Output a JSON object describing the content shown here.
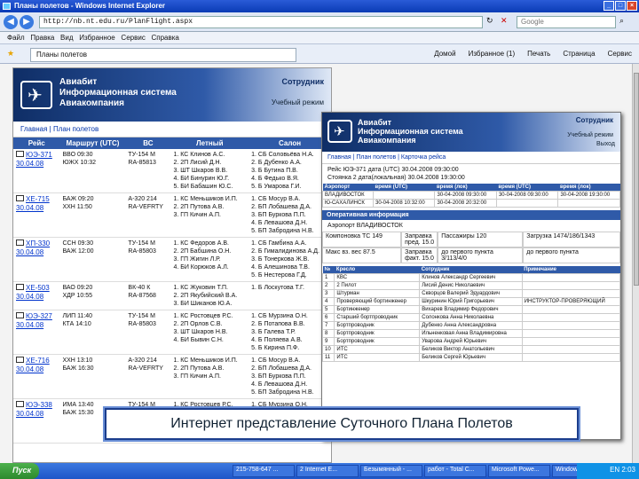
{
  "browser": {
    "title": "Планы полетов - Windows Internet Explorer",
    "url": "http://nb.nt.edu.ru/PlanFlight.aspx",
    "search_placeholder": "Google",
    "menu": [
      "Файл",
      "Правка",
      "Вид",
      "Избранное",
      "Сервис",
      "Справка"
    ],
    "tab_label": "Планы полетов",
    "tools": [
      "Домой",
      "Избранное (1)",
      "Печать",
      "Страница",
      "Сервис"
    ]
  },
  "main_page": {
    "brand_line1": "Авиабит",
    "brand_line2": "Информационная система",
    "brand_line3": "Авиакомпания",
    "role": "Сотрудник",
    "role_sub": "Учебный режим",
    "breadcrumb": "Главная | План полетов",
    "columns": [
      "Рейс",
      "Маршрут (UTC)",
      "ВС",
      "Летный",
      "Салон"
    ],
    "rows": [
      {
        "flight": "ЮЭ-371",
        "date": "30.04.08",
        "route": "ВВО 09:30\nЮЖХ 10:32",
        "aircraft": "ТУ-154 М\nRA-85813",
        "crew": "1. КС Клинов А.С.\n2. 2П Лисий Д.Н.\n3. ШТ Шкаров В.В.\n4. БИ Бинурин Ю.Г.\n5. БИ Бабашин Ю.С.",
        "cabin": "1. СБ Соловьёва Н.А.\n2. Б Дубенко А.А.\n3. Б Бутина П.В.\n4. Б Федько В.Я.\n5. Б Умарова Г.И."
      },
      {
        "flight": "ХЕ-715",
        "date": "30.04.08",
        "route": "БАЖ 09:20\nХХН 11:50",
        "aircraft": "А-320 214\nRA-VEFRTY",
        "crew": "1. КС Меньшиков И.П.\n2. 2П Путова А.В.\n3. ГП Кичин А.П.",
        "cabin": "1. СБ Мосур В.А.\n2. БП Лобашева Д.А.\n3. БП Буркова П.П.\n4. Б Левашова Д.Н.\n5. БП Забродина Н.В."
      },
      {
        "flight": "ХП-330",
        "date": "30.04.08",
        "route": "ССН 09:30\nВАЖ 12:00",
        "aircraft": "ТУ-154 М\nRA-85803",
        "crew": "1. КС Федоров А.В.\n2. 2П Бабшина О.Н.\n3. ГП Жигин Л.Р.\n4. БИ Корюков А.Л.",
        "cabin": "1. СБ Гамбина А.А.\n2. Б Гималидинова А.Д.\n3. Б Тонеркова Ж.В.\n4. Б Алешинова Т.В.\n5. Б Нестерова Г.Д."
      },
      {
        "flight": "ХЕ-503",
        "date": "30.04.08",
        "route": "ВАО 09:20\nХДР 10:55",
        "aircraft": "ВК-40 К\nRA-87568",
        "crew": "1. КС Жуковин Т.П.\n2. 2П Якубийский В.А.\n3. БИ Шиканов Ю.А.",
        "cabin": "1. Б Лоскутова Т.Г."
      },
      {
        "flight": "ЮЭ-327",
        "date": "30.04.08",
        "route": "ЛИП 11:40\nКТА 14:10",
        "aircraft": "ТУ-154 М\nRA-85803",
        "crew": "1. КС Ростовцев Р.С.\n2. 2П Орлов С.В.\n3. ШТ Шкаров Н.В.\n4. БИ Бывин С.Н.",
        "cabin": "1. СБ Мурзина О.Н.\n2. Б Потапова В.В.\n3. Б Галева Т.Р.\n4. Б Поляева А.В.\n5. Б Кирина П.Ф."
      },
      {
        "flight": "ХЕ-716",
        "date": "30.04.08",
        "route": "ХХН 13:10\nБАЖ 16:30",
        "aircraft": "А-320 214\nRA-VEFRTY",
        "crew": "1. КС Меньшиков И.П.\n2. 2П Путова А.В.\n3. ГП Кичин А.П.",
        "cabin": "1. СБ Мосур В.А.\n2. БП Лобашева Д.А.\n3. БП Буркова П.П.\n4. Б Левашова Д.Н.\n5. БП Забродина Н.В."
      },
      {
        "flight": "ЮЭ-338",
        "date": "30.04.08",
        "route": "ИМА 13:40\nБАЖ 15:30",
        "aircraft": "ТУ-154 М\nRA-85803",
        "crew": "1. КС Ростовцев Р.С.\n2. 2П Орлов С.В.\n3. ШТ Шкаров Н.В.\n4. БИ Бывин С.Н.",
        "cabin": "1. СБ Мурзина О.Н.\n2. Б Потапова В.В.\n3. Б Галева Т.Р.\n4. Б Поляева А.В.\n5. Б Кирина П.Ф."
      }
    ]
  },
  "overlay_page": {
    "brand_line1": "Авиабит",
    "brand_line2": "Информационная система",
    "brand_line3": "Авиакомпания",
    "role": "Сотрудник",
    "role_sub": "Учебный режим",
    "exit": "Выход",
    "breadcrumb": "Главная | План полетов | Карточка рейса",
    "card_line1": "Рейс     ЮЭ-371  дата (UTC)   30.04.2008  09:30:00",
    "card_line2": "Стоянка 2     дата(локальная)  30.04.2008  19:30:00",
    "sched_headers": [
      "Аэропорт",
      "время (UTC)",
      "время (лок)",
      "время (UTC)",
      "время (лок)"
    ],
    "sched_rows": [
      [
        "ВЛАДИВОСТОК",
        "",
        "30-04-2008 09:30:00",
        "30-04-2008 09:30:00",
        "30-04-2008 19:30:00"
      ],
      [
        "Ю-САХАЛИНСК",
        "30-04-2008 10:32:00",
        "30-04-2008 20:32:00",
        "",
        ""
      ]
    ],
    "op_title": "Оперативная информация",
    "op_airport": "Аэропорт ВЛАДИВОСТОК",
    "op_cells": [
      "Компоновка ТС 149",
      "Заправка пред. 15.0",
      "Пассажиры 120",
      "Загрузка 1474/186/1343",
      "Макс вз. вес 87.5",
      "Заправка факт. 15.0",
      "до первого пункта 3/113/4/0",
      "до первого пункта"
    ],
    "crew_headers": [
      "№",
      "Кресло",
      "Сотрудник",
      "Примечание"
    ],
    "crew_rows": [
      [
        "1",
        "КВС",
        "Клинов Александр Сергеевич",
        ""
      ],
      [
        "2",
        "2 Пилот",
        "Лисий Денис Николаевич",
        ""
      ],
      [
        "3",
        "Штурман",
        "Скворцов Валерий Эдуардович",
        ""
      ],
      [
        "4",
        "Проверяющий бортинженер",
        "Шкуринин Юрий Григорьевич",
        "ИНСТРУКТОР-ПРОВЕРЯЮЩИЙ"
      ],
      [
        "5",
        "Бортинженер",
        "Вихарев Владимир Федорович",
        ""
      ],
      [
        "6",
        "Старший бортпроводник",
        "Солонкова Анна Николаевна",
        ""
      ],
      [
        "7",
        "Бортпроводник",
        "Дубенко Анна Александровна",
        ""
      ],
      [
        "8",
        "Бортпроводник",
        "Ильненковая Анна Владимировна",
        ""
      ],
      [
        "9",
        "Бортпроводник",
        "Уварова Андрей Юрьевич",
        ""
      ],
      [
        "10",
        "ИТС",
        "Беликов Виктор Анатольевич",
        ""
      ],
      [
        "11",
        "ИТС",
        "Беликов Сергей Юрьевич",
        ""
      ]
    ]
  },
  "caption": "Интернет представление Суточного Плана Полетов",
  "taskbar": {
    "start": "Пуск",
    "buttons": [
      "215-758-647 ...",
      "2 Internet E...",
      "Безымянный - ...",
      "работ - Total C...",
      "Microsoft Powe...",
      "Windows Explo..."
    ],
    "clock": "EN  2:03"
  }
}
